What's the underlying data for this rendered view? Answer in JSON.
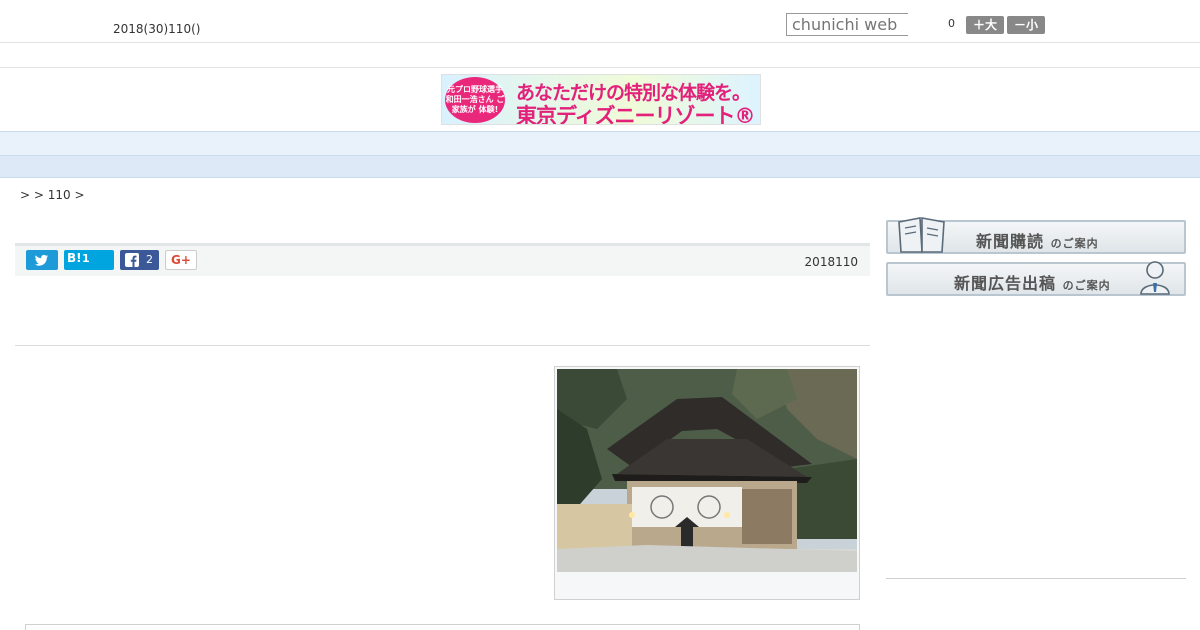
{
  "header": {
    "date": "2018(30)110()",
    "search_placeholder": "chunichi web",
    "count": "0",
    "font_larger": "＋大",
    "font_smaller": "－小"
  },
  "banner": {
    "badge_text": "元プロ野球選手 和田一浩さん ご家族が 体験!",
    "line1": "あなただけの特別な体験を。",
    "line2": "東京ディズニーリゾート®"
  },
  "nav": {
    "items": [
      "",
      "",
      "",
      "",
      "",
      "",
      "",
      "",
      ""
    ]
  },
  "breadcrumb": ">  > 110 >",
  "share": {
    "twitter_icon": "twitter-bird-icon",
    "hatena_label": "B!",
    "hatena_count": "1",
    "facebook_count": "2",
    "google_plus_label": "G+"
  },
  "article": {
    "date": "2018110"
  },
  "sidebar": {
    "subscribe_main": "新聞購読",
    "subscribe_suffix": "のご案内",
    "advertise_main": "新聞広告出稿",
    "advertise_suffix": "のご案内"
  },
  "colors": {
    "twitter": "#1d9bd8",
    "hatena": "#00a4de",
    "facebook": "#3b5998",
    "nav_bg": "#e9f2fb",
    "banner_pink": "#e3207a"
  }
}
